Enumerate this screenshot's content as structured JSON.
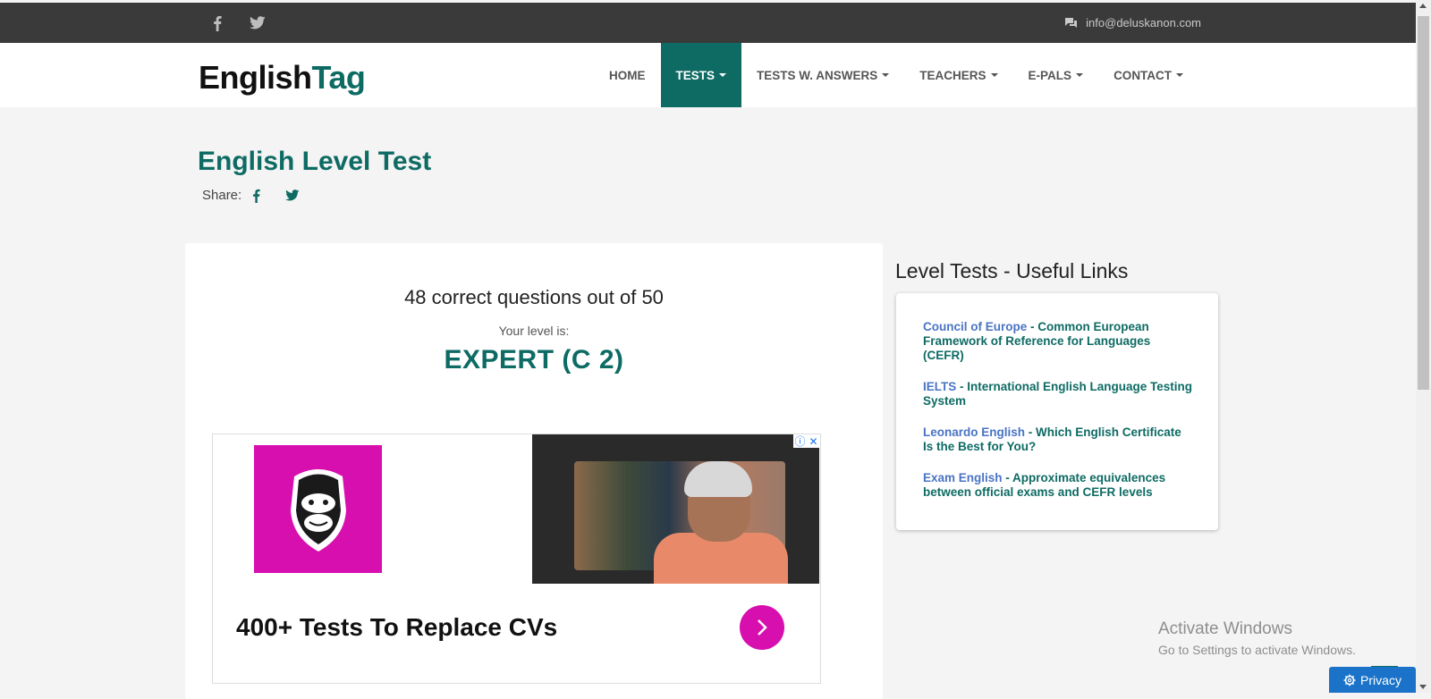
{
  "header": {
    "email": "info@deluskanon.com",
    "social_icons": [
      "facebook-icon",
      "twitter-icon"
    ]
  },
  "brand": {
    "part1": "English",
    "part2": "Tag"
  },
  "nav": {
    "items": [
      {
        "label": "HOME",
        "dropdown": false,
        "active": false
      },
      {
        "label": "TESTS",
        "dropdown": true,
        "active": true
      },
      {
        "label": "TESTS W. ANSWERS",
        "dropdown": true,
        "active": false
      },
      {
        "label": "TEACHERS",
        "dropdown": true,
        "active": false
      },
      {
        "label": "E-PALS",
        "dropdown": true,
        "active": false
      },
      {
        "label": "CONTACT",
        "dropdown": true,
        "active": false
      }
    ]
  },
  "page": {
    "title": "English Level Test",
    "share_label": "Share:"
  },
  "result": {
    "score_text": "48 correct questions out of 50",
    "level_label": "Your level is:",
    "level": "EXPERT (C 2)"
  },
  "ad": {
    "headline": "400+ Tests To Replace CVs"
  },
  "sidebar": {
    "heading": "Level Tests - Useful Links",
    "links": [
      {
        "source": "Council of Europe",
        "text": " - Common European Framework of Reference for Languages (CEFR)"
      },
      {
        "source": "IELTS",
        "text": " - International English Language Testing System"
      },
      {
        "source": "Leonardo English",
        "text": " - Which English Certificate Is the Best for You?"
      },
      {
        "source": "Exam English",
        "text": " - Approximate equivalences between official exams and CEFR levels"
      }
    ]
  },
  "os": {
    "watermark_title": "Activate Windows",
    "watermark_sub": "Go to Settings to activate Windows.",
    "privacy_label": "Privacy"
  },
  "colors": {
    "accent": "#0e6b64",
    "topbar": "#3a3a3a",
    "ad_magenta": "#d80faf",
    "link_blue": "#4a74c4"
  }
}
